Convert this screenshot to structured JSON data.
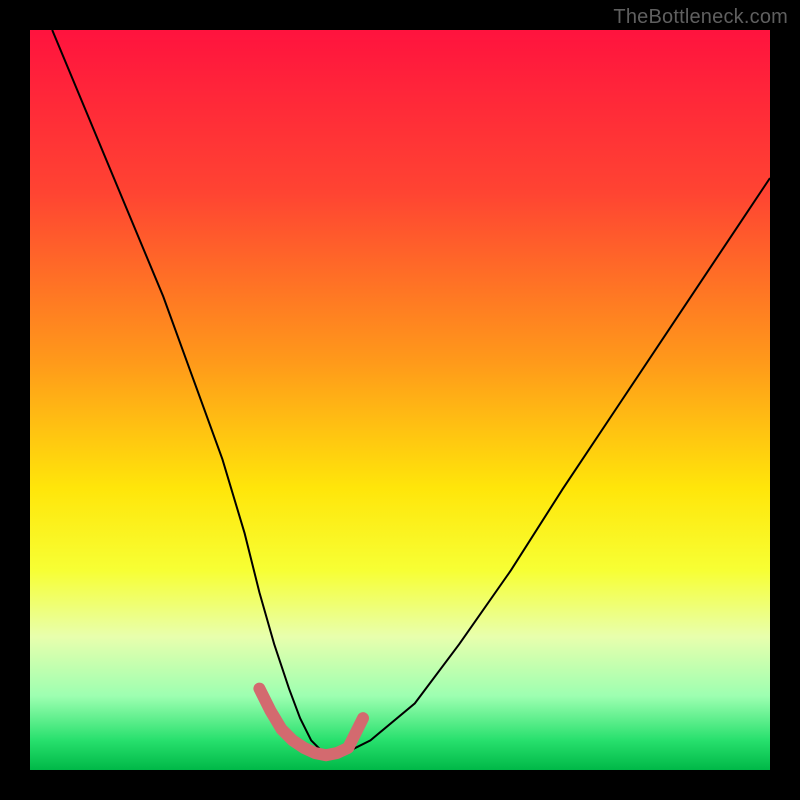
{
  "watermark": "TheBottleneck.com",
  "chart_data": {
    "type": "line",
    "title": "",
    "xlabel": "",
    "ylabel": "",
    "xlim": [
      0,
      100
    ],
    "ylim": [
      0,
      100
    ],
    "gradient_stops": [
      {
        "offset": 0,
        "color": "#ff133e"
      },
      {
        "offset": 22,
        "color": "#ff4432"
      },
      {
        "offset": 45,
        "color": "#ff9a1a"
      },
      {
        "offset": 62,
        "color": "#ffe60a"
      },
      {
        "offset": 73,
        "color": "#f7ff34"
      },
      {
        "offset": 82,
        "color": "#e8ffad"
      },
      {
        "offset": 90,
        "color": "#9dffb1"
      },
      {
        "offset": 96,
        "color": "#27e06d"
      },
      {
        "offset": 100,
        "color": "#00b847"
      }
    ],
    "series": [
      {
        "name": "bottleneck-curve",
        "stroke": "#000000",
        "stroke_width": 2,
        "x": [
          3,
          8,
          13,
          18,
          22,
          26,
          29,
          31,
          33,
          35,
          36.5,
          38,
          40,
          42,
          46,
          52,
          58,
          65,
          72,
          80,
          88,
          96,
          100
        ],
        "values": [
          100,
          88,
          76,
          64,
          53,
          42,
          32,
          24,
          17,
          11,
          7,
          4,
          2,
          2,
          4,
          9,
          17,
          27,
          38,
          50,
          62,
          74,
          80
        ]
      },
      {
        "name": "marker-band",
        "type": "scatter",
        "stroke": "#d36a6f",
        "stroke_width": 12,
        "x": [
          31,
          32.5,
          34,
          35.5,
          37,
          38.5,
          40,
          41.5,
          43,
          45
        ],
        "values": [
          11,
          8,
          5.5,
          4,
          3,
          2.3,
          2,
          2.3,
          3,
          7
        ]
      }
    ],
    "marker_dot": {
      "x": 45,
      "y": 7,
      "r": 5,
      "color": "#d36a6f"
    }
  }
}
